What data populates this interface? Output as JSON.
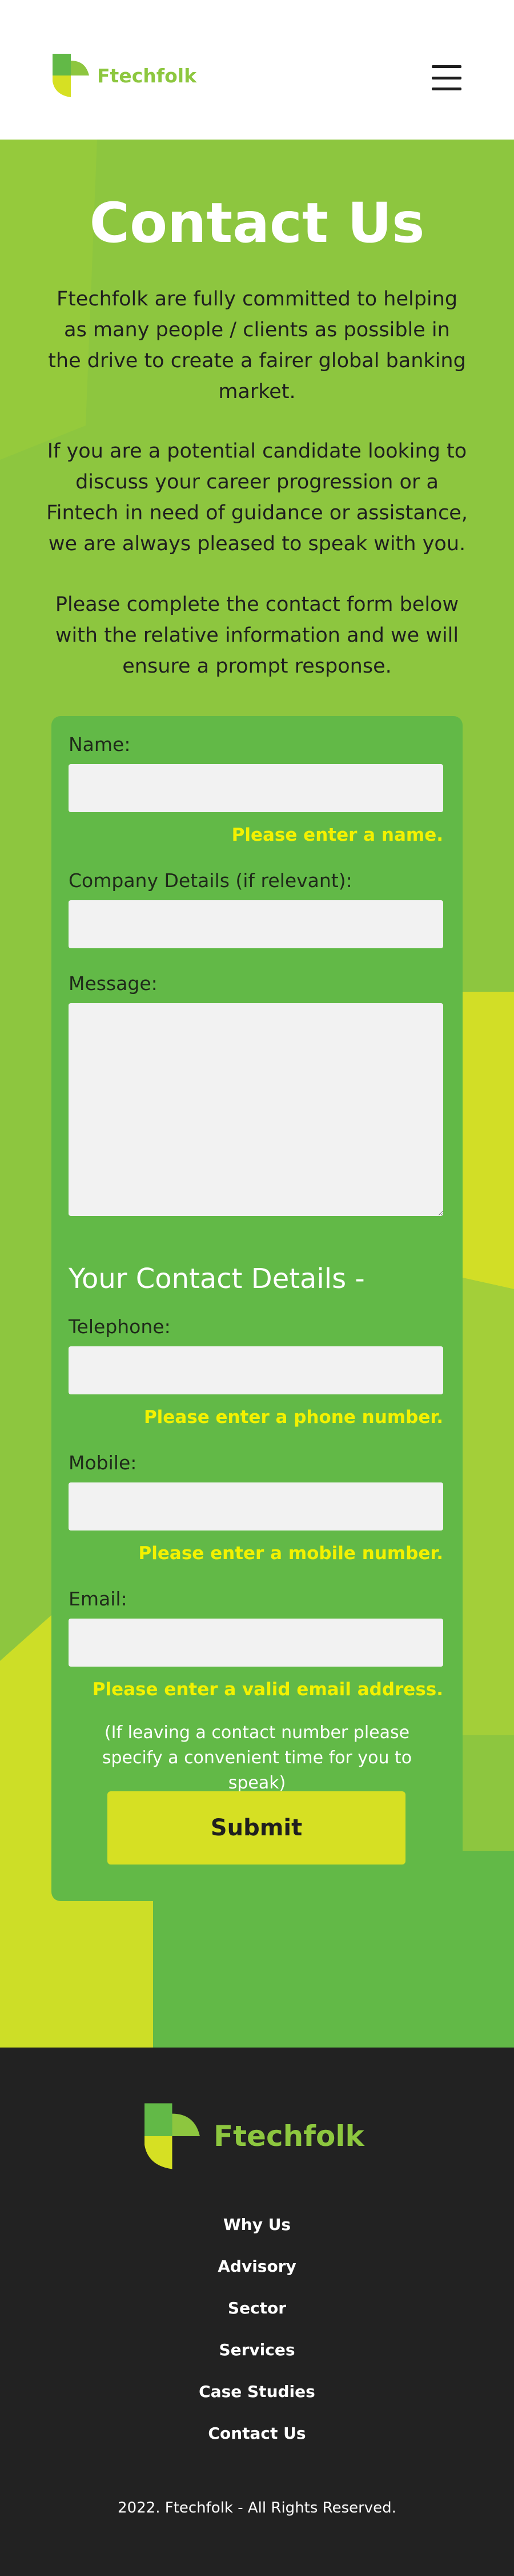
{
  "brand": {
    "name": "Ftechfolk",
    "logo_icon": "ftechfolk-logo-mark",
    "primary_color": "#8dc63f",
    "accent_color": "#d6e023"
  },
  "header": {
    "menu_icon": "hamburger-menu-icon"
  },
  "hero": {
    "title": "Contact Us",
    "paragraphs": [
      "Ftechfolk are fully committed to helping as many people / clients as possible in the drive to create a fairer global banking market.",
      "If you are a potential candidate looking to discuss your career progression or a Fintech in need of guidance or assistance, we are always pleased to speak with you.",
      "Please complete the contact form below with the relative information and we will ensure a prompt response."
    ]
  },
  "form": {
    "name_label": "Name:",
    "name_value": "",
    "name_error": "Please enter a name.",
    "company_label": "Company Details (if relevant):",
    "company_value": "",
    "message_label": "Message:",
    "message_value": "",
    "contact_heading": "Your Contact Details -",
    "telephone_label": "Telephone:",
    "telephone_value": "",
    "telephone_error": "Please enter a phone number.",
    "mobile_label": "Mobile:",
    "mobile_value": "",
    "mobile_error": "Please enter a mobile number.",
    "email_label": "Email:",
    "email_value": "",
    "email_error": "Please enter a valid email address.",
    "note": "(If leaving a contact number please specify a convenient time for you to speak)",
    "submit_label": "Submit",
    "error_color": "#f3f100"
  },
  "footer": {
    "brand_name": "Ftechfolk",
    "nav": [
      "Why Us",
      "Advisory",
      "Sector",
      "Services",
      "Case Studies",
      "Contact Us"
    ],
    "copyright": "2022. Ftechfolk - All Rights Reserved.",
    "background": "#222222"
  }
}
